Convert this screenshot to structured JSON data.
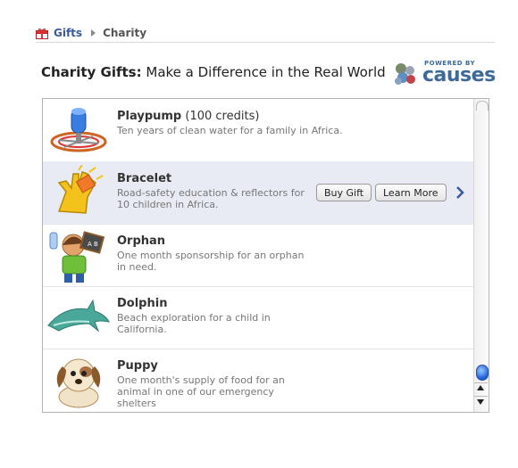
{
  "breadcrumb": {
    "root": "Gifts",
    "current": "Charity"
  },
  "header": {
    "title_bold": "Charity Gifts:",
    "title_rest": " Make a Difference in the Real World"
  },
  "powered_by": {
    "small": "POWERED BY",
    "brand": "causes"
  },
  "items": [
    {
      "name": "Playpump",
      "credits": " (100 credits)",
      "desc": "Ten years of clean water for a family in Africa.",
      "icon": "playpump-icon"
    },
    {
      "name": "Bracelet",
      "credits": "",
      "desc": "Road-safety education & reflectors for 10 children in Africa.",
      "icon": "bracelet-glove-icon"
    },
    {
      "name": "Orphan",
      "credits": "",
      "desc": "One month sponsorship for an orphan in need.",
      "icon": "orphan-child-icon"
    },
    {
      "name": "Dolphin",
      "credits": "",
      "desc": "Beach exploration for a child in California.",
      "icon": "dolphin-icon"
    },
    {
      "name": "Puppy",
      "credits": "",
      "desc": "One month's supply of food for an animal in one of our emergency shelters",
      "icon": "puppy-icon"
    }
  ],
  "actions": {
    "buy": "Buy Gift",
    "learn": "Learn More"
  },
  "colors": {
    "link": "#3b5998",
    "selected_row": "#e8ebf3",
    "causes_blue": "#3e6a9a"
  }
}
